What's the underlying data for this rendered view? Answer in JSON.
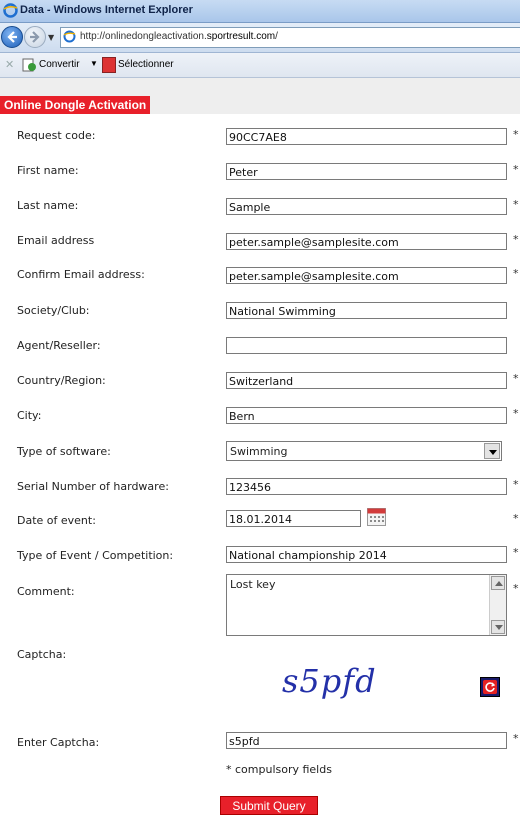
{
  "window": {
    "title": "Data - Windows Internet Explorer"
  },
  "address": {
    "prefix": "http://onlinedongleactivation.",
    "domain": "sportresult.com",
    "suffix": "/"
  },
  "toolbar": {
    "convert_label": "Convertir",
    "select_label": "Sélectionner"
  },
  "form": {
    "title": "Online Dongle Activation",
    "required_marker": "*",
    "fields": {
      "request_code": {
        "label": "Request code:",
        "value": "90CC7AE8"
      },
      "first_name": {
        "label": "First name:",
        "value": "Peter"
      },
      "last_name": {
        "label": "Last name:",
        "value": "Sample"
      },
      "email": {
        "label": "Email address",
        "value": "peter.sample@samplesite.com"
      },
      "confirm_email": {
        "label": "Confirm Email address:",
        "value": "peter.sample@samplesite.com"
      },
      "society": {
        "label": "Society/Club:",
        "value": "National Swimming"
      },
      "agent": {
        "label": "Agent/Reseller:",
        "value": ""
      },
      "country": {
        "label": "Country/Region:",
        "value": "Switzerland"
      },
      "city": {
        "label": "City:",
        "value": "Bern"
      },
      "software": {
        "label": "Type of software:",
        "value": "Swimming"
      },
      "serial": {
        "label": "Serial Number of hardware:",
        "value": "123456"
      },
      "date": {
        "label": "Date of event:",
        "value": "18.01.2014"
      },
      "event_type": {
        "label": "Type of Event / Competition:",
        "value": "National championship 2014"
      },
      "comment": {
        "label": "Comment:",
        "value": "Lost key"
      },
      "captcha": {
        "label": "Captcha:",
        "image_text": "s5pfd"
      },
      "enter_captcha": {
        "label": "Enter Captcha:",
        "value": "s5pfd"
      }
    },
    "compulsory_note": "* compulsory fields",
    "submit_label": "Submit Query"
  },
  "icons": {
    "ie": "ie-logo-icon",
    "back": "back-arrow-icon",
    "forward": "forward-arrow-icon",
    "calendar": "calendar-icon",
    "refresh": "refresh-captcha-icon"
  },
  "colors": {
    "accent_red": "#e8202a",
    "captcha_blue": "#2330a8"
  }
}
